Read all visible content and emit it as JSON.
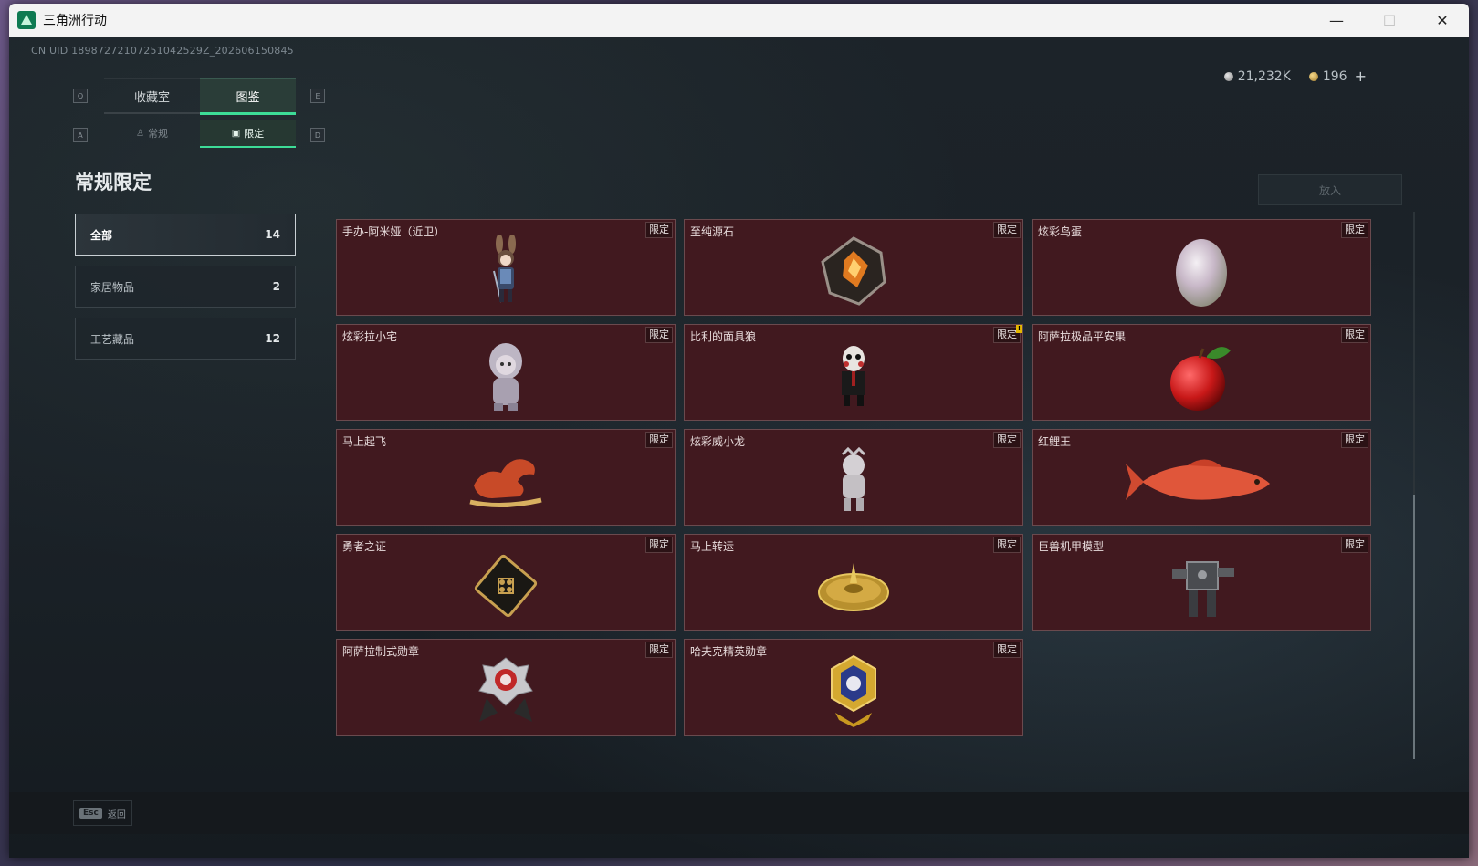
{
  "window": {
    "title": "三角洲行动",
    "minimize": "—",
    "maximize": "☐",
    "close": "✕"
  },
  "uid": "CN UID 18987272107251042529Z_202606150845",
  "main_tabs": [
    {
      "label": "收藏室",
      "active": false
    },
    {
      "label": "图鉴",
      "active": true
    }
  ],
  "main_tab_keys": {
    "left": "Q",
    "right": "E"
  },
  "sub_tabs": [
    {
      "label": "常规",
      "icon": "person-icon",
      "active": false
    },
    {
      "label": "限定",
      "icon": "frame-icon",
      "active": true
    }
  ],
  "sub_tab_keys": {
    "left": "A",
    "right": "D"
  },
  "currency": {
    "silver": "21,232K",
    "gold": "196",
    "plus": "+"
  },
  "section_title": "常规限定",
  "filters": [
    {
      "label": "全部",
      "count": "14",
      "active": true
    },
    {
      "label": "家居物品",
      "count": "2",
      "active": false
    },
    {
      "label": "工艺藏品",
      "count": "12",
      "active": false
    }
  ],
  "place_button": "放入",
  "items": [
    {
      "name": "手办-阿米娅（近卫）",
      "tag": "限定",
      "icon": "figure-amiya-icon"
    },
    {
      "name": "至纯源石",
      "tag": "限定",
      "icon": "originium-icon"
    },
    {
      "name": "炫彩鸟蛋",
      "tag": "限定",
      "icon": "egg-icon"
    },
    {
      "name": "炫彩拉小宅",
      "tag": "限定",
      "icon": "figure-hooded-icon"
    },
    {
      "name": "比利的面具狼",
      "tag": "限定",
      "icon": "puppet-icon",
      "warning": "!"
    },
    {
      "name": "阿萨拉极品平安果",
      "tag": "限定",
      "icon": "apple-icon"
    },
    {
      "name": "马上起飞",
      "tag": "限定",
      "icon": "horse-icon"
    },
    {
      "name": "炫彩威小龙",
      "tag": "限定",
      "icon": "figure-dragon-icon"
    },
    {
      "name": "红鲤王",
      "tag": "限定",
      "icon": "carp-icon"
    },
    {
      "name": "勇者之证",
      "tag": "限定",
      "icon": "card-icon"
    },
    {
      "name": "马上转运",
      "tag": "限定",
      "icon": "compass-icon"
    },
    {
      "name": "巨兽机甲模型",
      "tag": "限定",
      "icon": "mech-icon"
    },
    {
      "name": "阿萨拉制式勋章",
      "tag": "限定",
      "icon": "medal-icon"
    },
    {
      "name": "哈夫克精英勋章",
      "tag": "限定",
      "icon": "badge-icon"
    }
  ],
  "bottom": {
    "esc_key": "Esc",
    "esc_label": "返回"
  },
  "colors": {
    "accent": "#3ddc97",
    "card_bg": "#41191f"
  }
}
